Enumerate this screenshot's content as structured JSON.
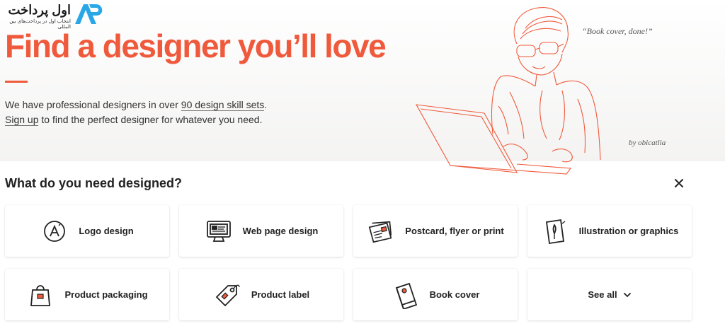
{
  "brand": {
    "name": "اول پرداخت",
    "tagline": "انتخاب اول در پرداخت‌های بین المللی",
    "logo_text": "AP",
    "color": "#2aa7e6"
  },
  "hero": {
    "title": "Find a designer you’ll love",
    "line1_prefix": "We have professional designers in over ",
    "line1_link": "90 design skill sets",
    "line1_suffix": ".",
    "line2_link": "Sign up",
    "line2_suffix": " to find the perfect designer for whatever you need.",
    "quote": "“Book cover, done!”",
    "credit": "by obicatlia",
    "accent_color": "#f05a3c"
  },
  "categories": {
    "heading": "What do you need designed?",
    "close_icon": "close-icon",
    "items": [
      {
        "label": "Logo design",
        "icon": "logo-icon"
      },
      {
        "label": "Web page design",
        "icon": "monitor-icon"
      },
      {
        "label": "Postcard, flyer or print",
        "icon": "postcard-icon"
      },
      {
        "label": "Illustration or graphics",
        "icon": "illustration-icon"
      },
      {
        "label": "Product packaging",
        "icon": "bag-icon"
      },
      {
        "label": "Product label",
        "icon": "tag-icon"
      },
      {
        "label": "Book cover",
        "icon": "book-icon"
      },
      {
        "label": "See all",
        "icon": "chevron-down-icon"
      }
    ]
  }
}
